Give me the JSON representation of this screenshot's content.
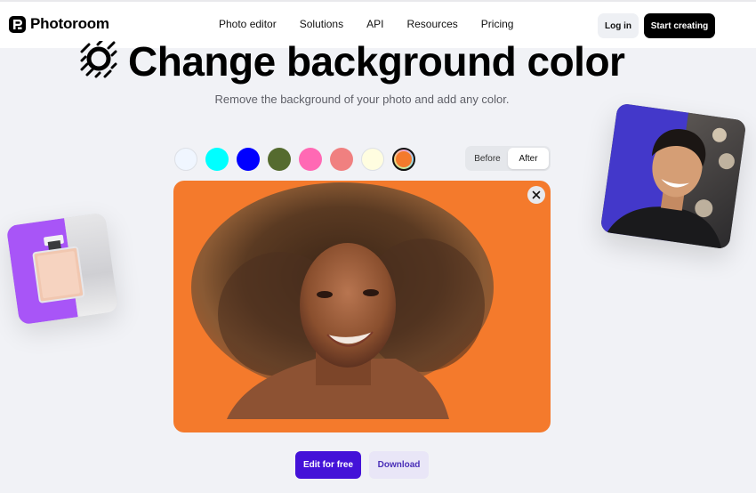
{
  "header": {
    "brand": "Photoroom",
    "nav": [
      "Photo editor",
      "Solutions",
      "API",
      "Resources",
      "Pricing"
    ],
    "login_label": "Log in",
    "start_label": "Start creating"
  },
  "hero": {
    "icon": "sun-stripes-icon",
    "title": "Change background color",
    "subtitle": "Remove the background of your photo and add any color."
  },
  "swatches": [
    {
      "name": "alice-blue",
      "color": "#f0f6ff"
    },
    {
      "name": "cyan",
      "color": "#00ffff"
    },
    {
      "name": "blue",
      "color": "#0000ff"
    },
    {
      "name": "olive-green",
      "color": "#556b2f"
    },
    {
      "name": "hot-pink",
      "color": "#ff69b4"
    },
    {
      "name": "light-coral",
      "color": "#f08080"
    },
    {
      "name": "light-yellow",
      "color": "#fffde0"
    },
    {
      "name": "custom-orange",
      "color": "#f47a2c",
      "selected": true
    }
  ],
  "toggle": {
    "options": [
      "Before",
      "After"
    ],
    "active": "After"
  },
  "preview": {
    "background_color": "#f47a2c",
    "close_icon": "close-icon"
  },
  "actions": {
    "edit_label": "Edit for free",
    "download_label": "Download"
  },
  "colors": {
    "primary": "#4412d8",
    "download_bg": "#e9e6f7",
    "page_bg": "#f1f2f6"
  }
}
